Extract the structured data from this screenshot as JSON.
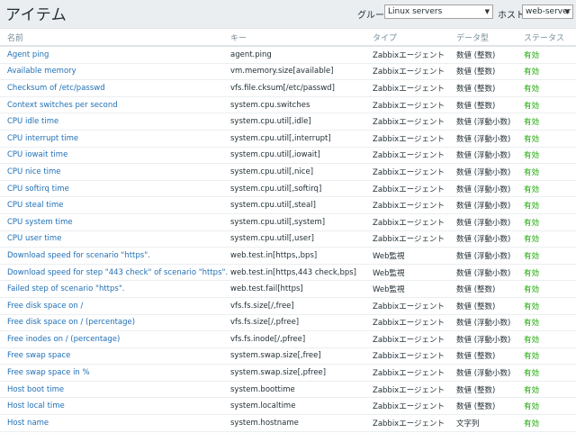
{
  "page": {
    "title": "アイテム"
  },
  "filters": {
    "group_label": "グループ",
    "group_value": "Linux servers",
    "host_label": "ホスト",
    "host_value": "web-server"
  },
  "table": {
    "headers": [
      "名前",
      "キー",
      "タイプ",
      "データ型",
      "ステータス"
    ],
    "rows": [
      {
        "name": "Agent ping",
        "key": "agent.ping",
        "type": "Zabbixエージェント",
        "dtype": "数値 (整数)",
        "status": "有効"
      },
      {
        "name": "Available memory",
        "key": "vm.memory.size[available]",
        "type": "Zabbixエージェント",
        "dtype": "数値 (整数)",
        "status": "有効"
      },
      {
        "name": "Checksum of /etc/passwd",
        "key": "vfs.file.cksum[/etc/passwd]",
        "type": "Zabbixエージェント",
        "dtype": "数値 (整数)",
        "status": "有効"
      },
      {
        "name": "Context switches per second",
        "key": "system.cpu.switches",
        "type": "Zabbixエージェント",
        "dtype": "数値 (整数)",
        "status": "有効"
      },
      {
        "name": "CPU idle time",
        "key": "system.cpu.util[,idle]",
        "type": "Zabbixエージェント",
        "dtype": "数値 (浮動小数)",
        "status": "有効"
      },
      {
        "name": "CPU interrupt time",
        "key": "system.cpu.util[,interrupt]",
        "type": "Zabbixエージェント",
        "dtype": "数値 (浮動小数)",
        "status": "有効"
      },
      {
        "name": "CPU iowait time",
        "key": "system.cpu.util[,iowait]",
        "type": "Zabbixエージェント",
        "dtype": "数値 (浮動小数)",
        "status": "有効"
      },
      {
        "name": "CPU nice time",
        "key": "system.cpu.util[,nice]",
        "type": "Zabbixエージェント",
        "dtype": "数値 (浮動小数)",
        "status": "有効"
      },
      {
        "name": "CPU softirq time",
        "key": "system.cpu.util[,softirq]",
        "type": "Zabbixエージェント",
        "dtype": "数値 (浮動小数)",
        "status": "有効"
      },
      {
        "name": "CPU steal time",
        "key": "system.cpu.util[,steal]",
        "type": "Zabbixエージェント",
        "dtype": "数値 (浮動小数)",
        "status": "有効"
      },
      {
        "name": "CPU system time",
        "key": "system.cpu.util[,system]",
        "type": "Zabbixエージェント",
        "dtype": "数値 (浮動小数)",
        "status": "有効"
      },
      {
        "name": "CPU user time",
        "key": "system.cpu.util[,user]",
        "type": "Zabbixエージェント",
        "dtype": "数値 (浮動小数)",
        "status": "有効"
      },
      {
        "name": "Download speed for scenario \"https\".",
        "key": "web.test.in[https,,bps]",
        "type": "Web監視",
        "dtype": "数値 (浮動小数)",
        "status": "有効"
      },
      {
        "name": "Download speed for step \"443 check\" of scenario \"https\".",
        "key": "web.test.in[https,443 check,bps]",
        "type": "Web監視",
        "dtype": "数値 (浮動小数)",
        "status": "有効"
      },
      {
        "name": "Failed step of scenario \"https\".",
        "key": "web.test.fail[https]",
        "type": "Web監視",
        "dtype": "数値 (整数)",
        "status": "有効"
      },
      {
        "name": "Free disk space on /",
        "key": "vfs.fs.size[/,free]",
        "type": "Zabbixエージェント",
        "dtype": "数値 (整数)",
        "status": "有効"
      },
      {
        "name": "Free disk space on / (percentage)",
        "key": "vfs.fs.size[/,pfree]",
        "type": "Zabbixエージェント",
        "dtype": "数値 (浮動小数)",
        "status": "有効"
      },
      {
        "name": "Free inodes on / (percentage)",
        "key": "vfs.fs.inode[/,pfree]",
        "type": "Zabbixエージェント",
        "dtype": "数値 (浮動小数)",
        "status": "有効"
      },
      {
        "name": "Free swap space",
        "key": "system.swap.size[,free]",
        "type": "Zabbixエージェント",
        "dtype": "数値 (整数)",
        "status": "有効"
      },
      {
        "name": "Free swap space in %",
        "key": "system.swap.size[,pfree]",
        "type": "Zabbixエージェント",
        "dtype": "数値 (浮動小数)",
        "status": "有効"
      },
      {
        "name": "Host boot time",
        "key": "system.boottime",
        "type": "Zabbixエージェント",
        "dtype": "数値 (整数)",
        "status": "有効"
      },
      {
        "name": "Host local time",
        "key": "system.localtime",
        "type": "Zabbixエージェント",
        "dtype": "数値 (整数)",
        "status": "有効"
      },
      {
        "name": "Host name",
        "key": "system.hostname",
        "type": "Zabbixエージェント",
        "dtype": "文字列",
        "status": "有効"
      }
    ]
  },
  "colors": {
    "link": "#1f6fb5",
    "enabled": "#18a600",
    "header_text": "#768d99",
    "background": "#ebeef0"
  }
}
